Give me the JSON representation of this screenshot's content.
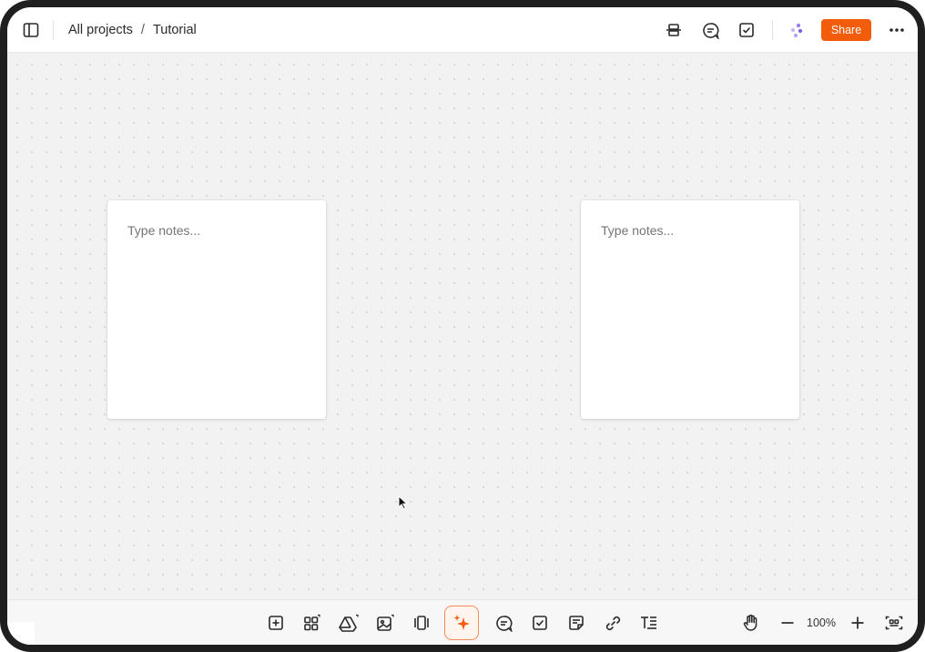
{
  "header": {
    "breadcrumb": [
      "All projects",
      "Tutorial"
    ],
    "breadcrumb_separator": "/",
    "share_label": "Share",
    "icons": [
      "sidebar-icon",
      "page-view-icon",
      "comments-icon",
      "tasks-icon",
      "ai-assistant-icon",
      "more-icon"
    ]
  },
  "canvas": {
    "notes": [
      {
        "placeholder": "Type notes..."
      },
      {
        "placeholder": "Type notes..."
      }
    ]
  },
  "toolbar": {
    "tools": [
      "add-block",
      "apps",
      "google-drive",
      "image",
      "carousel",
      "ai-sparkle",
      "comment",
      "task",
      "note",
      "link",
      "text"
    ],
    "zoom_level": "100%"
  },
  "colors": {
    "accent": "#f25c0a",
    "canvas_bg": "#f2f2f2",
    "frame": "#1f1f1f"
  }
}
